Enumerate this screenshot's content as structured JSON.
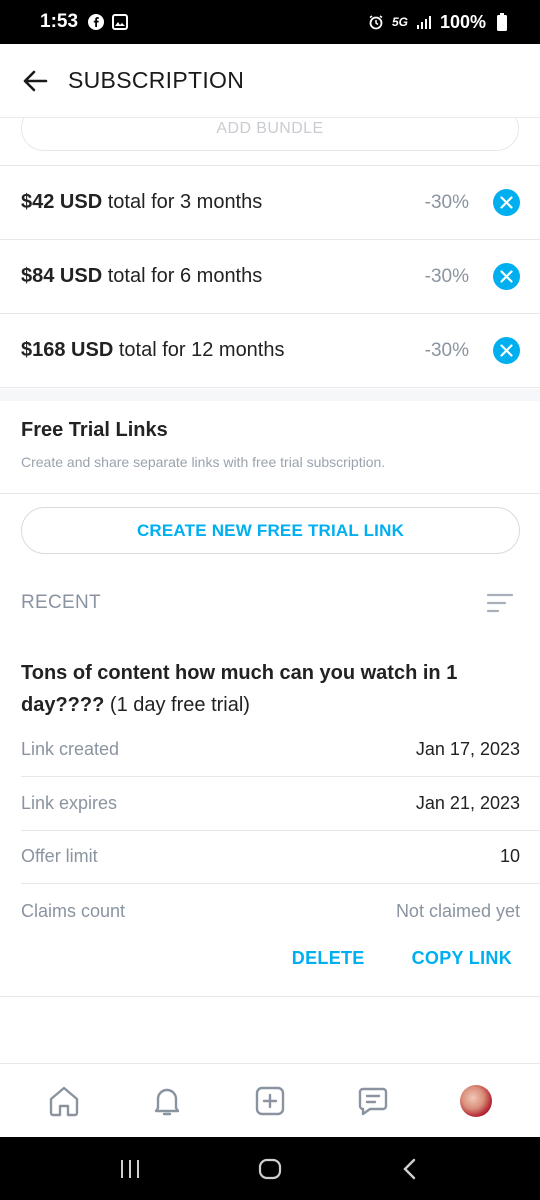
{
  "status_bar": {
    "time": "1:53",
    "network": "5G",
    "battery": "100%"
  },
  "header": {
    "title": "SUBSCRIPTION"
  },
  "bundles": {
    "add_label": "ADD BUNDLE",
    "items": [
      {
        "price": "$42 USD",
        "text": "total for 3 months",
        "discount": "-30%"
      },
      {
        "price": "$84 USD",
        "text": "total for 6 months",
        "discount": "-30%"
      },
      {
        "price": "$168 USD",
        "text": "total for 12 months",
        "discount": "-30%"
      }
    ]
  },
  "free_trial": {
    "title": "Free Trial Links",
    "description": "Create and share separate links with free trial subscription.",
    "create_label": "CREATE NEW FREE TRIAL LINK",
    "recent_label": "RECENT"
  },
  "link": {
    "name": "Tons of content how much can you watch in 1 day????",
    "suffix": "(1 day free trial)",
    "details": [
      {
        "label": "Link created",
        "value": "Jan 17, 2023"
      },
      {
        "label": "Link expires",
        "value": "Jan 21, 2023"
      },
      {
        "label": "Offer limit",
        "value": "10"
      },
      {
        "label": "Claims count",
        "value": "Not claimed yet"
      }
    ],
    "delete_label": "DELETE",
    "copy_label": "COPY LINK"
  },
  "colors": {
    "accent": "#00aff0",
    "muted": "#8a94a0"
  },
  "icons": {
    "nav": [
      "home-icon",
      "bell-icon",
      "plus-square-icon",
      "message-icon",
      "avatar"
    ]
  }
}
